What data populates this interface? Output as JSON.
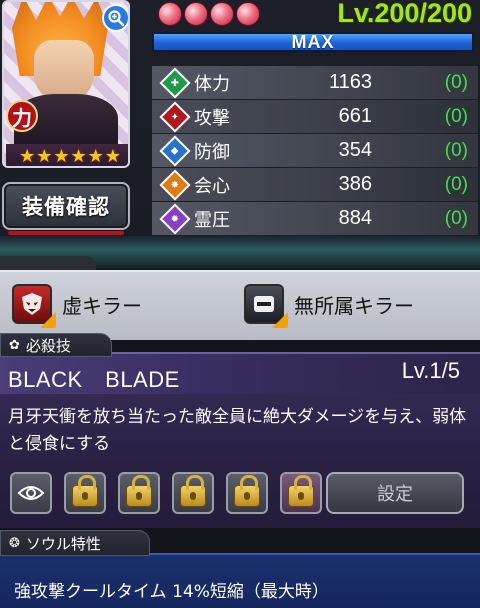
{
  "character": {
    "attribute_label": "力",
    "stars": [
      "★",
      "★",
      "★",
      "★",
      "★",
      "★"
    ],
    "level": "Lv.200/200",
    "max_label": "MAX",
    "equip_button": "装備確認"
  },
  "stats": [
    {
      "label": "体力",
      "value": "1163",
      "bonus": "(0)",
      "icon": "hp-icon",
      "color": "#1f9a4a"
    },
    {
      "label": "攻撃",
      "value": "661",
      "bonus": "(0)",
      "icon": "attack-icon",
      "color": "#b01820"
    },
    {
      "label": "防御",
      "value": "354",
      "bonus": "(0)",
      "icon": "defense-icon",
      "color": "#2b72c9"
    },
    {
      "label": "会心",
      "value": "386",
      "bonus": "(0)",
      "icon": "critical-icon",
      "color": "#e07a12"
    },
    {
      "label": "霊圧",
      "value": "884",
      "bonus": "(0)",
      "icon": "reiatsu-icon",
      "color": "#8a3fc0"
    }
  ],
  "killers": [
    {
      "label": "虚キラー",
      "icon": "hollow-killer-icon"
    },
    {
      "label": "無所属キラー",
      "icon": "unaffiliated-killer-icon"
    }
  ],
  "skill": {
    "tab_label": "必殺技",
    "name": "BLACK　BLADE",
    "level": "Lv.1/5",
    "description": "月牙天衝を放ち当たった敵全員に絶大ダメージを与え、弱体と侵食にする",
    "settings_button": "設定"
  },
  "soul": {
    "tab_label": "ソウル特性",
    "text": "強攻撃クールタイム 14%短縮（最大時）"
  },
  "colors": {
    "level_green": "#a6e41a",
    "max_bar_blue": "#1e63d6",
    "bonus_green": "#3fe04a",
    "skill_purple": "#3b2e5c",
    "soul_blue": "#1b2f6e"
  }
}
